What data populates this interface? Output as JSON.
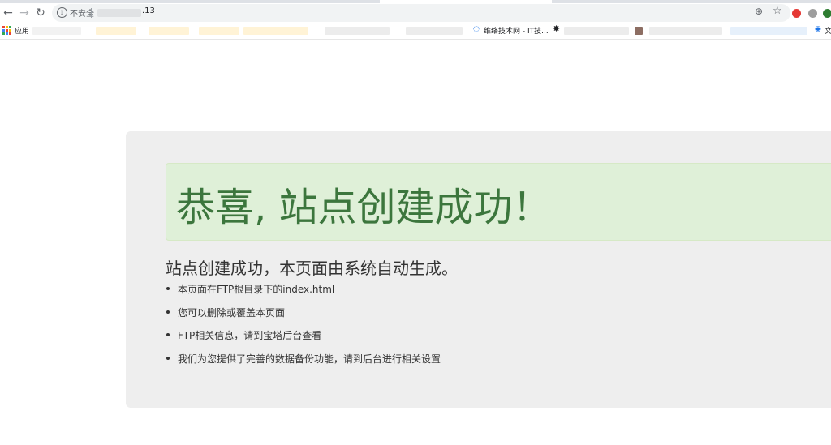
{
  "browser": {
    "nav": {
      "back_icon": "←",
      "forward_icon": "→",
      "reload_icon": "↻"
    },
    "omnibox": {
      "info_icon": "i",
      "security_label": "不安全",
      "url_suffix": ".13",
      "zoom_icon": "⊕",
      "star_icon": "☆"
    },
    "extensions": [
      {
        "name": "extension-red-icon",
        "color": "#e53935"
      },
      {
        "name": "extension-swirl-icon",
        "color": "#9e9e9e"
      },
      {
        "name": "extension-green-icon",
        "color": "#2e7d32"
      }
    ],
    "bookmarks": {
      "apps_label": "应用",
      "apps_colors": [
        "#ea4335",
        "#fbbc05",
        "#34a853",
        "#4285f4",
        "#ea4335",
        "#fbbc05",
        "#34a853",
        "#4285f4",
        "#ea4335"
      ],
      "visible_label": "维络技术网 - IT技...",
      "star_glyph": "✸",
      "last_label": "文"
    }
  },
  "page": {
    "headline": "恭喜, 站点创建成功！",
    "lead": "站点创建成功，本页面由系统自动生成。",
    "items": [
      "本页面在FTP根目录下的index.html",
      "您可以删除或覆盖本页面",
      "FTP相关信息，请到宝塔后台查看",
      "我们为您提供了完善的数据备份功能，请到后台进行相关设置"
    ],
    "colors": {
      "success_text": "#3c763d",
      "success_bg": "#dff0d8",
      "jumbotron_bg": "#eeeeee"
    }
  }
}
